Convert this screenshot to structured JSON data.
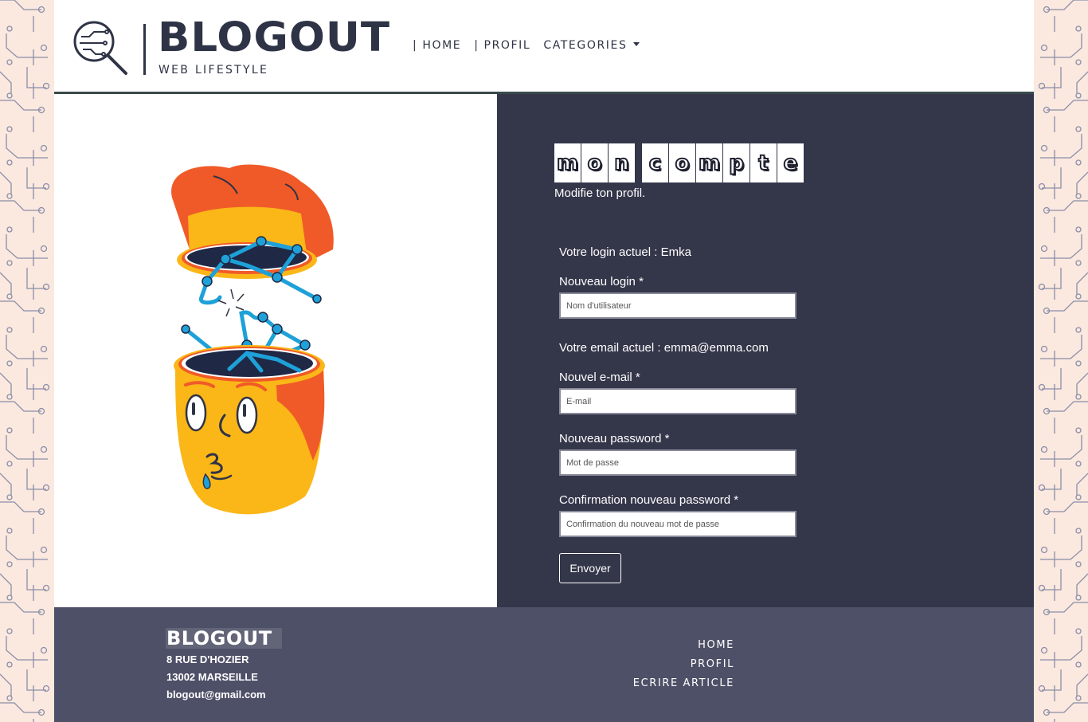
{
  "header": {
    "logo_word": "BLOGOUT",
    "logo_tagline": "WEB LIFESTYLE",
    "nav": [
      {
        "label": "HOME"
      },
      {
        "label": "PROFIL"
      },
      {
        "label": "CATEGORIES"
      }
    ]
  },
  "panel": {
    "title_words": [
      [
        "m",
        "o",
        "n"
      ],
      [
        "c",
        "o",
        "m",
        "p",
        "t",
        "e"
      ]
    ],
    "title": "mon compte",
    "subtitle": "Modifie ton profil.",
    "current_login": "Votre login actuel : Emka",
    "login_label": "Nouveau login *",
    "login_placeholder": "Nom d'utilisateur",
    "current_email": "Votre email actuel : emma@emma.com",
    "email_label": "Nouvel e-mail *",
    "email_placeholder": "E-mail",
    "password_label": "Nouveau password *",
    "password_placeholder": "Mot de passe",
    "confirm_label": "Confirmation nouveau password *",
    "confirm_placeholder": "Confirmation du nouveau mot de passe",
    "submit_label": "Envoyer"
  },
  "footer": {
    "logo": "BLOGOUT",
    "address_line1": "8 RUE D'HOZIER",
    "address_line2": "13002 MARSEILLE",
    "email": "blogout@gmail.com",
    "links": [
      "HOME",
      "PROFIL",
      "ECRIRE ARTICLE"
    ]
  },
  "colors": {
    "background_pattern": "#fbe8df",
    "circuit_lines": "#8a8fa8",
    "panel": "#34364a",
    "footer": "#4e5068",
    "brand_dark": "#2f3346",
    "accent_orange": "#f05a28",
    "accent_yellow": "#fbb718",
    "accent_blue": "#1ea1d8"
  }
}
